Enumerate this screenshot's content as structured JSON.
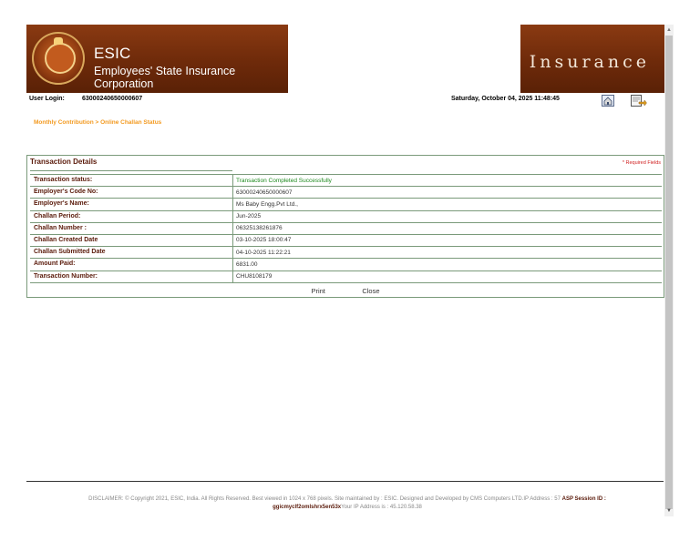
{
  "header": {
    "brand_title": "ESIC",
    "brand_subtitle": "Employees' State Insurance Corporation",
    "right_word": "Insurance"
  },
  "userbar": {
    "user_label": "User Login:",
    "user_value": "63000240650000607",
    "datetime": "Saturday, October 04, 2025 11:48:45"
  },
  "breadcrumb": "Monthly Contribution > Online Challan Status",
  "panel": {
    "title": "Transaction Details",
    "required": "* Required Fields",
    "rows": [
      {
        "label": "Transaction status:",
        "value": "Transaction Completed Successfully"
      },
      {
        "label": "Employer's Code No:",
        "value": "63000240650000607"
      },
      {
        "label": "Employer's Name:",
        "value": "Ms Baby Engg.Pvt Ltd.,"
      },
      {
        "label": "Challan Period:",
        "value": "Jun-2025"
      },
      {
        "label": "Challan Number :",
        "value": "06325138261876"
      },
      {
        "label": "Challan Created Date",
        "value": "03-10-2025 18:00:47"
      },
      {
        "label": "Challan Submitted Date",
        "value": "04-10-2025 11:22:21"
      },
      {
        "label": "Amount Paid:",
        "value": "6831.00"
      },
      {
        "label": "Transaction Number:",
        "value": "CHU8108179"
      }
    ],
    "print_label": "Print",
    "close_label": "Close"
  },
  "footer": {
    "disclaimer": "DISCLAIMER: © Copyright 2021, ESIC, India. All Rights Reserved. Best viewed in 1024 x 768 pixels. Site maintained by : ESIC. Designed and Developed by CMS Computers LTD.IP Address : 57",
    "session_label": "ASP Session ID :",
    "session_id": "ggicmyclf2omlshrx5en53x",
    "your_ip": "Your IP Address is : 45.120.58.38"
  },
  "colors": {
    "banner": "#6e2a0a",
    "label_text": "#5a1a0a",
    "breadcrumb": "#f39a20",
    "success": "#1e8a1e",
    "required": "#d02020"
  },
  "icons": [
    "home-icon",
    "logout-icon",
    "scroll-up-icon",
    "scroll-down-icon"
  ]
}
